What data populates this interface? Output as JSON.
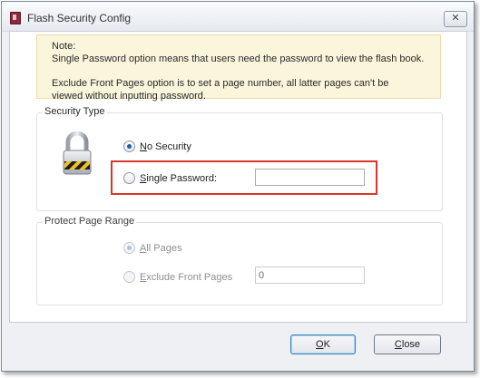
{
  "window": {
    "title": "Flash Security Config",
    "close_glyph": "✕"
  },
  "note": {
    "heading": "Note:",
    "line1": "Single Password option means that users need the password to view the flash book.",
    "line2": "Exclude Front Pages option is to set a page number, all latter pages can't be",
    "line3": "viewed without inputting password."
  },
  "security_type": {
    "title": "Security Type",
    "no_security": {
      "access_key": "N",
      "rest": "o Security",
      "checked": true
    },
    "single_password": {
      "access_key": "S",
      "rest": "ingle Password:",
      "checked": false,
      "value": ""
    }
  },
  "page_range": {
    "title": "Protect Page Range",
    "all_pages": {
      "access_key": "A",
      "rest": "ll Pages",
      "checked": true,
      "enabled": false
    },
    "exclude_front": {
      "access_key": "E",
      "rest": "xclude Front Pages",
      "checked": false,
      "enabled": false,
      "value": "0"
    }
  },
  "buttons": {
    "ok": {
      "access_key": "O",
      "rest": "K"
    },
    "close": {
      "access_key": "C",
      "rest": "lose"
    }
  },
  "colors": {
    "highlight": "#d9352b",
    "note_bg": "#fbf5dc",
    "radio_selected": "#1c5ea8"
  },
  "icons": {
    "app": "flash-book-icon",
    "lock": "padlock-icon"
  }
}
